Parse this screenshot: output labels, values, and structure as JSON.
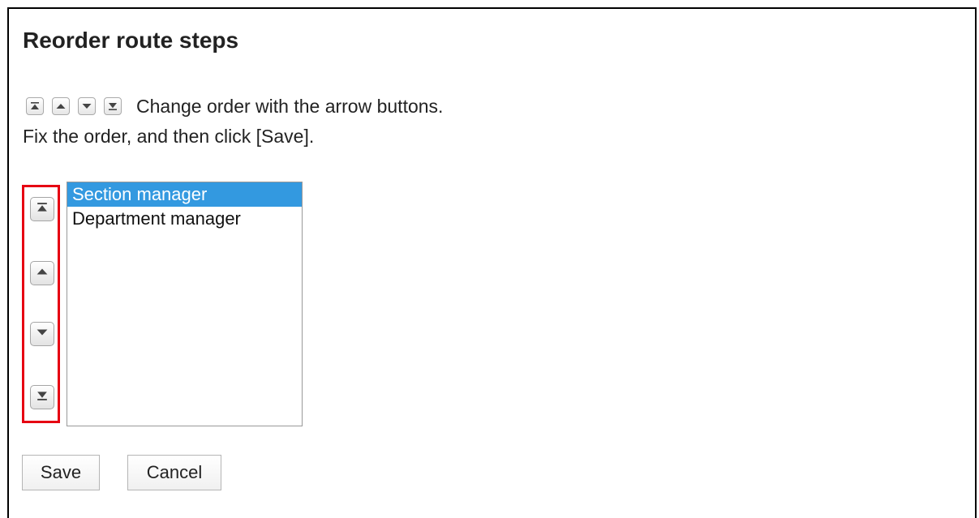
{
  "dialog": {
    "title": "Reorder route steps",
    "instructions_line1": "Change order with the arrow buttons.",
    "instructions_line2": "Fix the order, and then click [Save]."
  },
  "legend_icons": [
    "move-top-icon",
    "move-up-icon",
    "move-down-icon",
    "move-bottom-icon"
  ],
  "order_controls": [
    {
      "name": "move-to-top-button",
      "icon": "move-top-icon"
    },
    {
      "name": "move-up-button",
      "icon": "move-up-icon"
    },
    {
      "name": "move-down-button",
      "icon": "move-down-icon"
    },
    {
      "name": "move-to-bottom-button",
      "icon": "move-bottom-icon"
    }
  ],
  "route_steps": {
    "items": [
      "Section manager",
      "Department manager"
    ],
    "selected_index": 0
  },
  "buttons": {
    "save_label": "Save",
    "cancel_label": "Cancel"
  },
  "colors": {
    "selection": "#3399e0",
    "highlight_box": "#e60012"
  }
}
